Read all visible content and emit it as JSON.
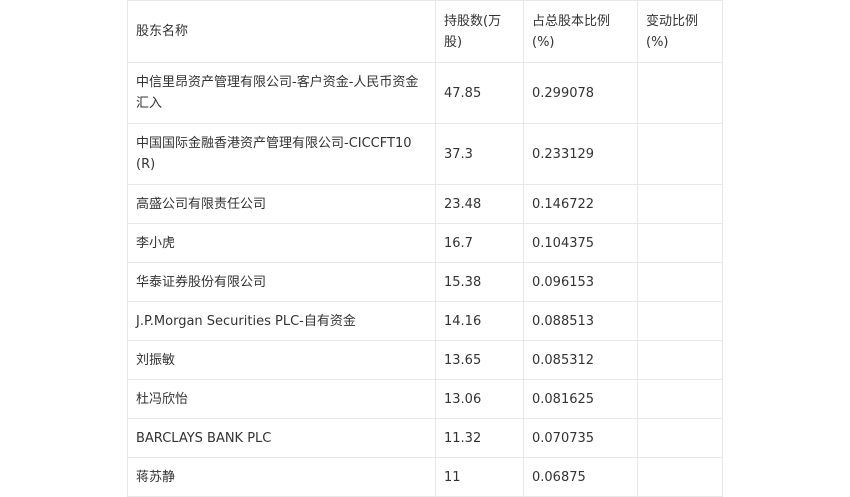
{
  "table": {
    "headers": [
      "股东名称",
      "持股数(万股)",
      "占总股本比例(%)",
      "变动比例(%)"
    ],
    "rows": [
      {
        "name": "中信里昂资产管理有限公司-客户资金-人民币资金汇入",
        "shares": "47.85",
        "ratio": "0.299078",
        "change": ""
      },
      {
        "name": "中国国际金融香港资产管理有限公司-CICCFT10(R)",
        "shares": "37.3",
        "ratio": "0.233129",
        "change": ""
      },
      {
        "name": "高盛公司有限责任公司",
        "shares": "23.48",
        "ratio": "0.146722",
        "change": ""
      },
      {
        "name": "李小虎",
        "shares": "16.7",
        "ratio": "0.104375",
        "change": ""
      },
      {
        "name": "华泰证券股份有限公司",
        "shares": "15.38",
        "ratio": "0.096153",
        "change": ""
      },
      {
        "name": "J.P.Morgan Securities PLC-自有资金",
        "shares": "14.16",
        "ratio": "0.088513",
        "change": ""
      },
      {
        "name": "刘振敏",
        "shares": "13.65",
        "ratio": "0.085312",
        "change": ""
      },
      {
        "name": "杜冯欣怡",
        "shares": "13.06",
        "ratio": "0.081625",
        "change": ""
      },
      {
        "name": "BARCLAYS BANK PLC",
        "shares": "11.32",
        "ratio": "0.070735",
        "change": ""
      },
      {
        "name": "蒋苏静",
        "shares": "11",
        "ratio": "0.06875",
        "change": ""
      }
    ]
  }
}
